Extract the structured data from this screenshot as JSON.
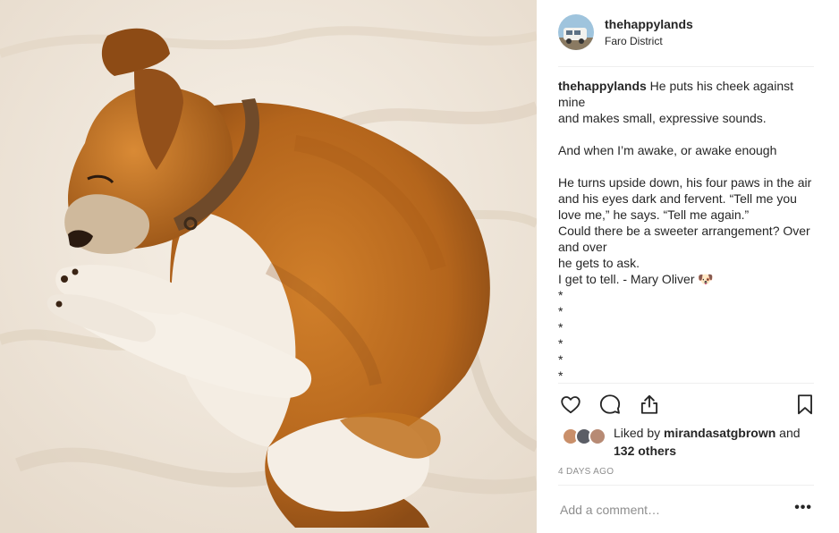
{
  "post": {
    "username": "thehappylands",
    "location": "Faro District",
    "caption_author": "thehappylands",
    "caption_text": " He puts his cheek against mine\nand makes small, expressive sounds.\n\nAnd when I’m awake, or awake enough\n\nHe turns upside down, his four paws in the air and his eyes dark and fervent. “Tell me you love me,” he says. “Tell me again.”\nCould there be a sweeter arrangement? Over and over\nhe gets to ask.\nI get to tell. - Mary Oliver 🐶\n*\n*\n*\n*\n*\n*",
    "likes_prefix": "Liked by ",
    "likes_user": "mirandasatgbrown",
    "likes_mid": " and ",
    "likes_others": "132 others",
    "timestamp": "4 DAYS AGO",
    "comment_placeholder": "Add a comment…",
    "more_label": "•••"
  },
  "icons": {
    "like": "heart-icon",
    "comment": "speech-bubble-icon",
    "share": "share-icon",
    "save": "bookmark-icon"
  },
  "colors": {
    "text": "#262626",
    "muted": "#8e8e8e",
    "divider": "#efefef",
    "fur": "#c0711e"
  }
}
